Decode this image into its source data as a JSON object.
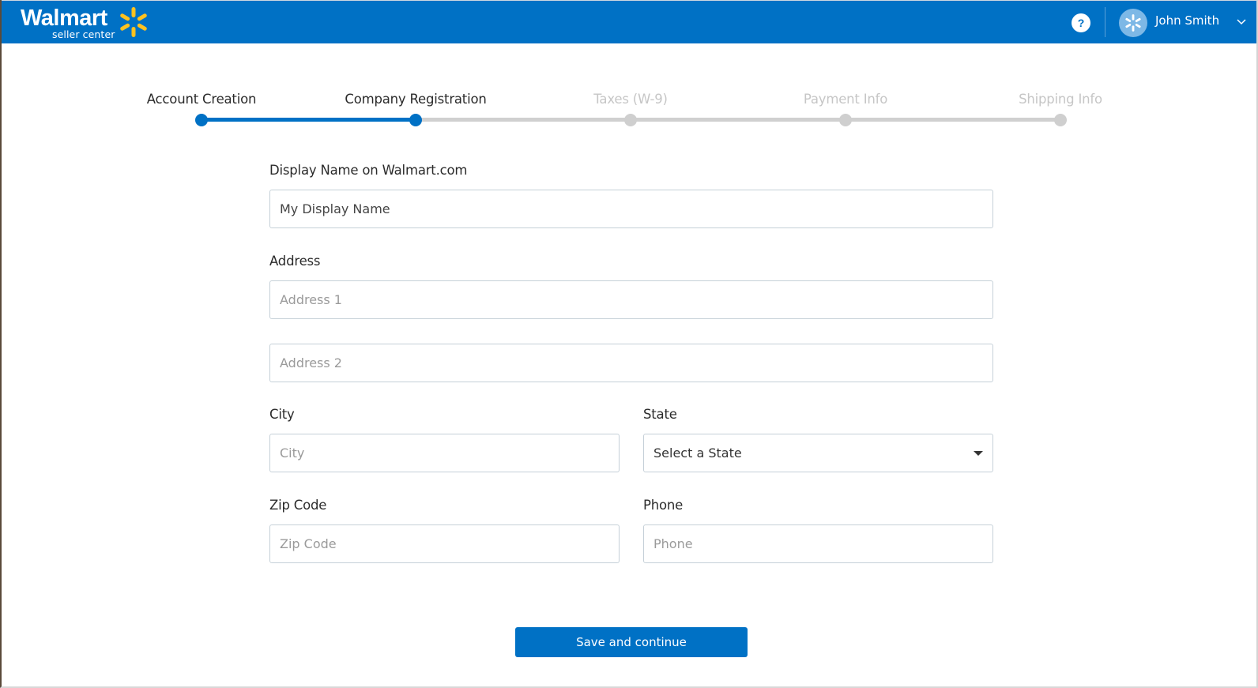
{
  "header": {
    "logo_text": "Walmart",
    "logo_subtext": "seller center",
    "logo_icon": "walmart-spark-icon",
    "help_label": "?",
    "user_name": "John Smith",
    "brand_color": "#0071c5",
    "spark_color": "#ffc220"
  },
  "stepper": {
    "current_step": 2,
    "steps": [
      {
        "label": "Account Creation",
        "status": "complete"
      },
      {
        "label": "Company Registration",
        "status": "current"
      },
      {
        "label": "Taxes (W-9)",
        "status": "upcoming"
      },
      {
        "label": "Payment Info",
        "status": "upcoming"
      },
      {
        "label": "Shipping Info",
        "status": "upcoming"
      }
    ]
  },
  "form": {
    "display_name": {
      "label": "Display Name on Walmart.com",
      "value": "My Display Name",
      "placeholder": ""
    },
    "address": {
      "label": "Address",
      "address1": {
        "value": "",
        "placeholder": "Address 1"
      },
      "address2": {
        "value": "",
        "placeholder": "Address 2"
      }
    },
    "city": {
      "label": "City",
      "value": "",
      "placeholder": "City"
    },
    "state": {
      "label": "State",
      "selected": "Select a State"
    },
    "zip": {
      "label": "Zip Code",
      "value": "",
      "placeholder": "Zip Code"
    },
    "phone": {
      "label": "Phone",
      "value": "",
      "placeholder": "Phone"
    }
  },
  "actions": {
    "save_label": "Save and continue"
  }
}
